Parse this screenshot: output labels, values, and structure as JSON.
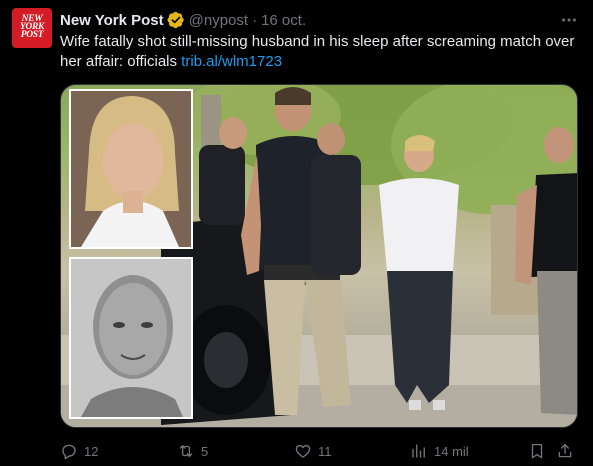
{
  "author": {
    "avatar_lines": [
      "NEW",
      "YORK",
      "POST"
    ],
    "display_name": "New York Post",
    "handle": "@nypost",
    "separator": "·",
    "date": "16 oct."
  },
  "tweet": {
    "text": "Wife fatally shot still-missing husband in his sleep after screaming match over her affair: officials ",
    "link": "trib.al/wlm1723"
  },
  "actions": {
    "replies": "12",
    "retweets": "5",
    "likes": "11",
    "views": "14 mil"
  },
  "colors": {
    "background": "#000000",
    "text": "#e7e9ea",
    "muted": "#71767b",
    "link": "#1d9bf0",
    "brand_red": "#d51b25",
    "verified_gold": "#e2b719"
  },
  "icons": {
    "more": "more-icon",
    "reply": "reply-icon",
    "retweet": "retweet-icon",
    "like": "like-icon",
    "views": "views-icon",
    "bookmark": "bookmark-icon",
    "share": "share-icon",
    "verified": "verified-badge-icon"
  }
}
